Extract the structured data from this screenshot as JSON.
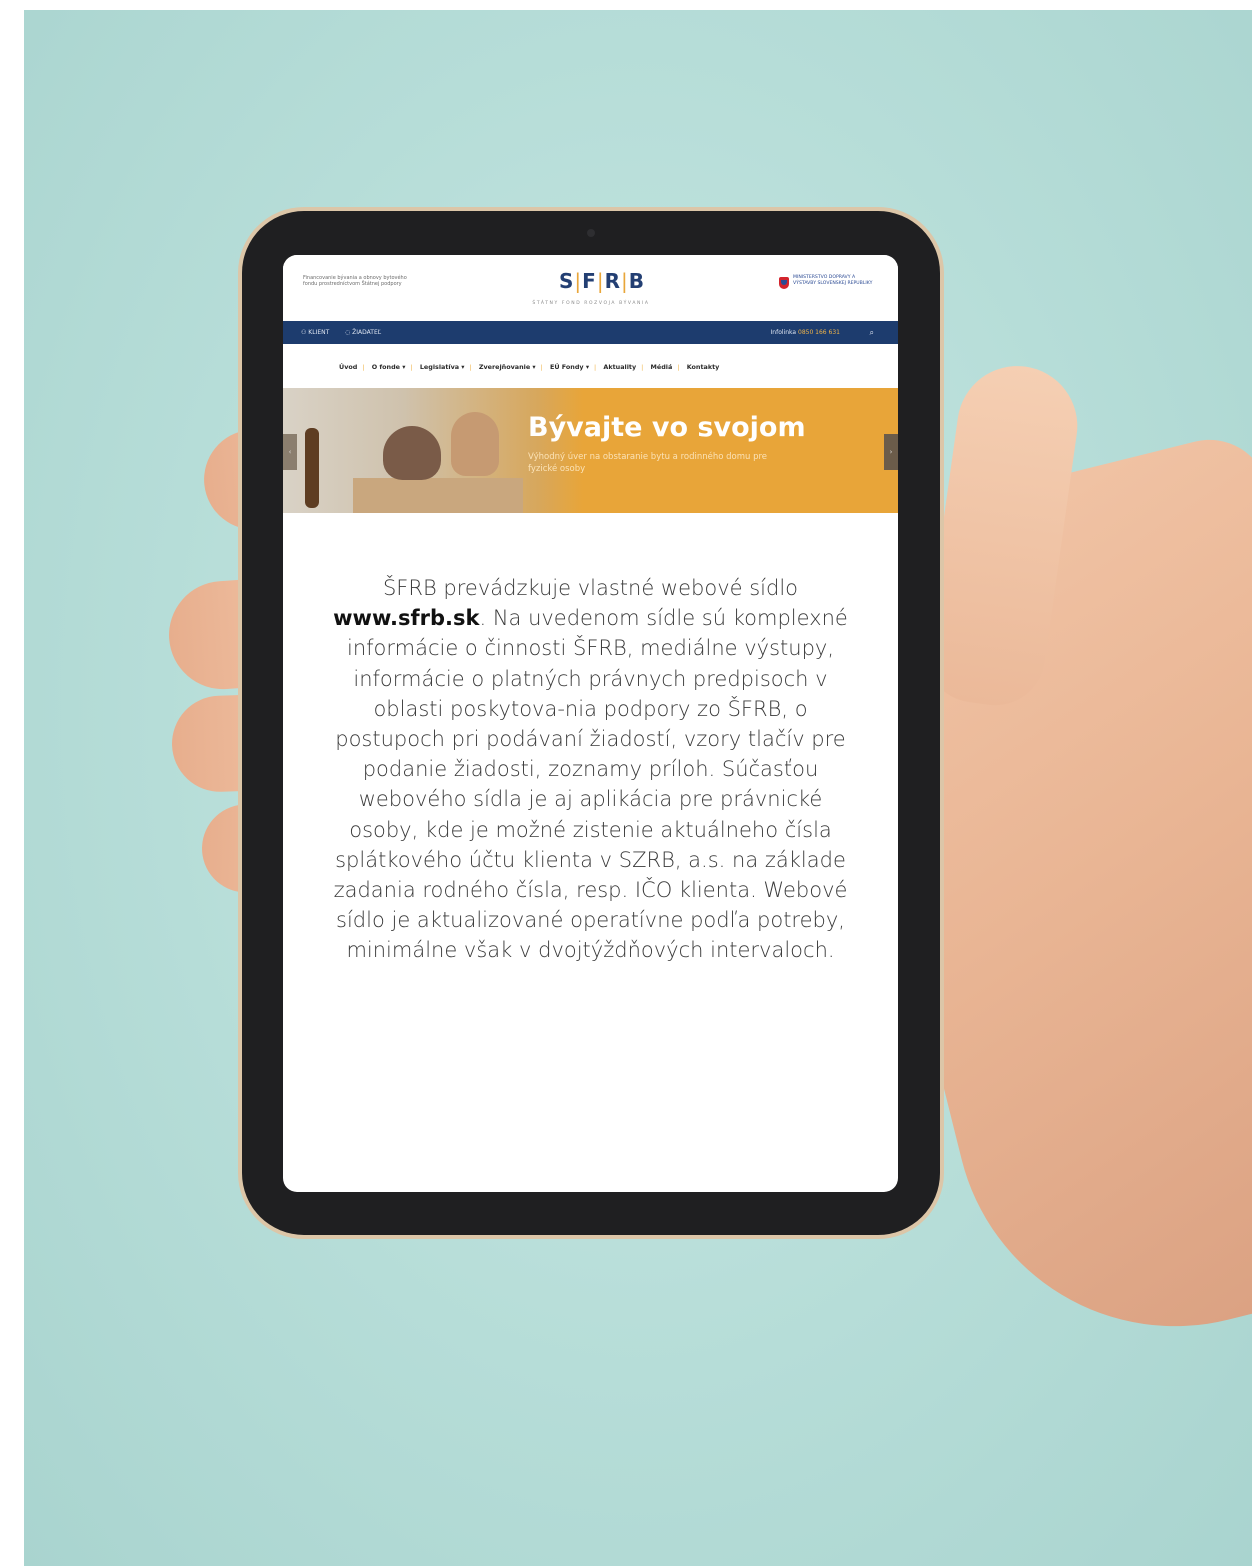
{
  "site": {
    "header": {
      "tagline": "Financovanie bývania a obnovy bytového fondu prostredníctvom Štátnej podpory",
      "logo_prefix": "S",
      "logo_f": "F",
      "logo_r": "R",
      "logo_b": "B",
      "logo_subtitle": "ŠTÁTNY FOND ROZVOJA BÝVANIA",
      "ministry": "MINISTERSTVO DOPRAVY A VÝSTAVBY SLOVENSKEJ REPUBLIKY"
    },
    "topbar": {
      "client": "KLIENT",
      "applicant": "ŽIADATEĽ",
      "info_label": "Infolinka",
      "info_number": "0850 166 631"
    },
    "menu": [
      "Úvod",
      "O fonde",
      "Legislatíva",
      "Zverejňovanie",
      "EÚ Fondy",
      "Aktuality",
      "Médiá",
      "Kontakty"
    ],
    "hero": {
      "title": "Bývajte vo svojom",
      "subtitle": "Výhodný úver na obstaranie bytu a rodinného domu pre fyzické osoby"
    }
  },
  "body": {
    "intro": "ŠFRB prevádzkuje vlastné webové sídlo",
    "url": "www.sfrb.sk",
    "rest": ". Na uvedenom sídle sú komplexné informácie o činnosti ŠFRB, mediálne výstupy, informácie o platných právnych predpisoch v oblasti poskytova-nia podpory zo ŠFRB, o postupoch pri podávaní žiadostí, vzory tlačív pre podanie žiadosti, zoznamy príloh. Súčasťou webového sídla je aj aplikácia pre právnické osoby, kde je možné zistenie aktuálneho čísla splátkového účtu klienta v SZRB, a.s. na základe zadania rodného čísla, resp. IČO klienta. Webové sídlo je aktualizované operatívne podľa potreby, minimálne však v dvojtýždňových intervaloch."
  },
  "colors": {
    "background": "#b6ddd8",
    "navy": "#1d3c6e",
    "accent": "#e8a539",
    "bezel": "#1f1f21"
  }
}
